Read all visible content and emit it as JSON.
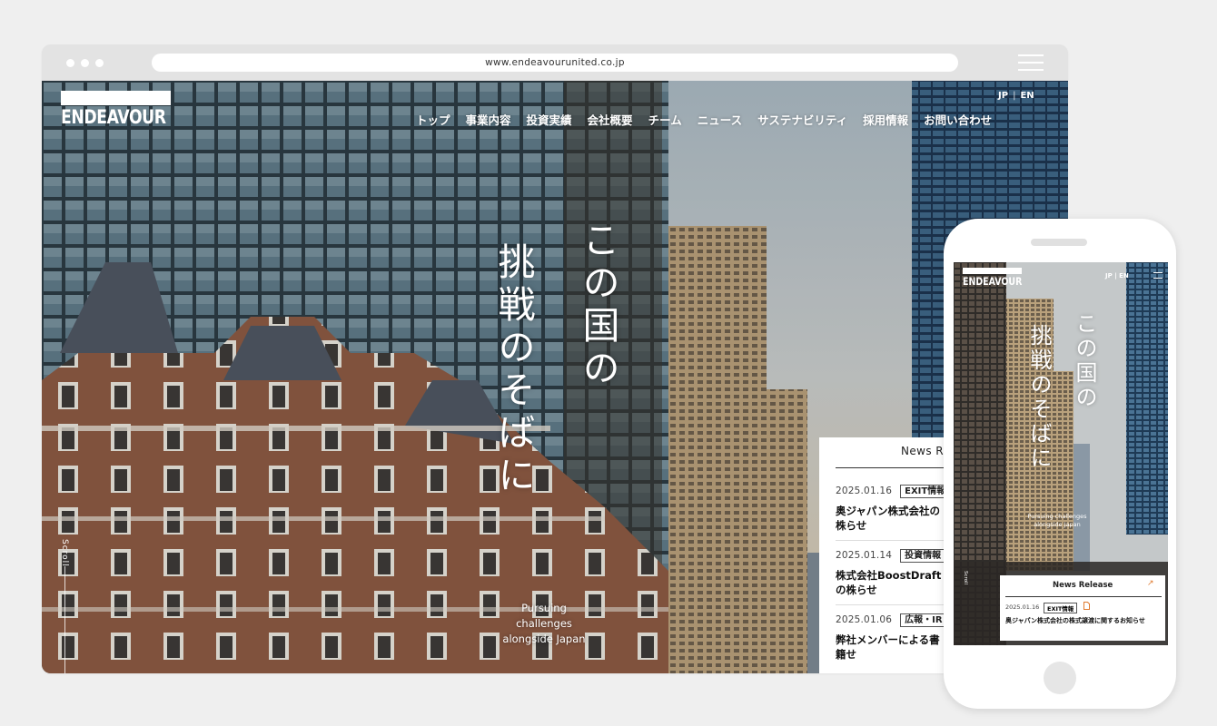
{
  "browser": {
    "url": "www.endeavourunited.co.jp"
  },
  "site": {
    "logo_text": "ENDEAVOUR",
    "lang": {
      "jp": "JP",
      "separator": "|",
      "en": "EN"
    },
    "nav": [
      "トップ",
      "事業内容",
      "投資実績",
      "会社概要",
      "チーム",
      "ニュース",
      "サステナビリティ",
      "採用情報",
      "お問い合わせ"
    ],
    "tagline_line1": "この国の",
    "tagline_line2": "挑戦のそばに",
    "subtitle_line1": "Pursuing challenges",
    "subtitle_line2": "alongside Japan",
    "scroll_label": "Scroll"
  },
  "news": {
    "title": "News Re",
    "items": [
      {
        "date": "2025.01.16",
        "tag": "EXIT情報",
        "text": "奥ジャパン株式会社の株らせ"
      },
      {
        "date": "2025.01.14",
        "tag": "投資情報",
        "text": "株式会社BoostDraftの株らせ"
      },
      {
        "date": "2025.01.06",
        "tag": "広報・IR",
        "text": "弊社メンバーによる書籍せ"
      }
    ]
  },
  "mobile": {
    "logo_text": "ENDEAVOUR",
    "lang": "JP  |  EN",
    "tagline_line1": "この国の",
    "tagline_line2": "挑戦のそばに",
    "subtitle_line1": "Pursuing challenges",
    "subtitle_line2": "alongside Japan",
    "scroll_label": "Scroll",
    "news_title": "News Release",
    "news_arrow": "↗",
    "news_date": "2025.01.16",
    "news_tag": "EXIT情報",
    "news_pdf": "PDF",
    "news_text": "奥ジャパン株式会社の株式譲渡に関するお知らせ"
  },
  "colors": {
    "page_bg": "#efefef",
    "chrome": "#e3e3e3",
    "accent": "#e07a2f",
    "text_dark": "#111111"
  }
}
